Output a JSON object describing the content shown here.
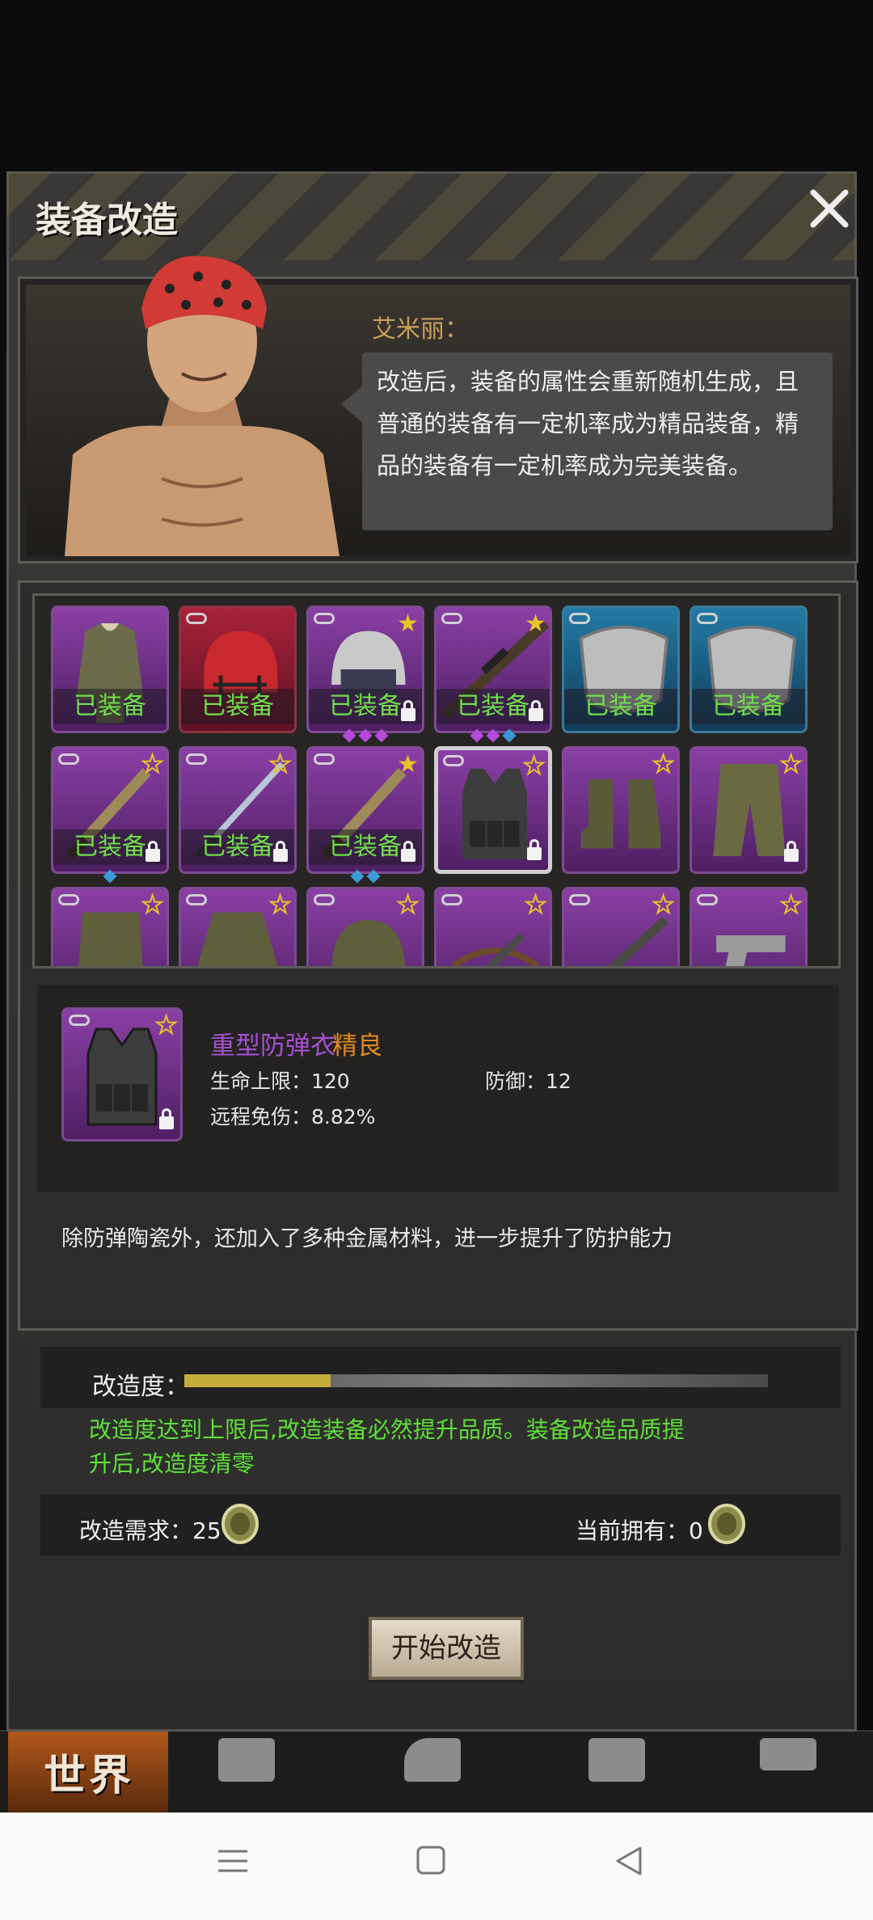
{
  "dialog": {
    "title": "装备改造",
    "npc_name": "艾米丽：",
    "npc_speech": "改造后，装备的属性会重新随机生成，且普通的装备有一定机率成为精品装备，精品的装备有一定机率成为完美装备。"
  },
  "inventory": {
    "equipped_label": "已装备",
    "slots": [
      {
        "icon": "parka-jacket-icon",
        "frame": "purple",
        "equipped": true,
        "linked": false,
        "star": "none",
        "locked": false,
        "gems": []
      },
      {
        "icon": "football-helmet-icon",
        "frame": "red",
        "equipped": true,
        "linked": true,
        "star": "none",
        "locked": false,
        "gems": []
      },
      {
        "icon": "police-helmet-icon",
        "frame": "purple",
        "equipped": true,
        "linked": true,
        "star": "filled",
        "locked": true,
        "gems": [
          "purple",
          "purple",
          "purple"
        ]
      },
      {
        "icon": "sniper-rifle-icon",
        "frame": "purple",
        "equipped": true,
        "linked": true,
        "star": "filled",
        "locked": true,
        "gems": [
          "purple",
          "purple",
          "blue"
        ]
      },
      {
        "icon": "metal-shield-icon",
        "frame": "blue",
        "equipped": true,
        "linked": true,
        "star": "none",
        "locked": false,
        "gems": []
      },
      {
        "icon": "metal-shield-icon",
        "frame": "blue",
        "equipped": true,
        "linked": true,
        "star": "none",
        "locked": false,
        "gems": []
      },
      {
        "icon": "machete-icon",
        "frame": "purple",
        "equipped": true,
        "linked": true,
        "star": "hollow",
        "locked": true,
        "gems": [
          "blue"
        ]
      },
      {
        "icon": "katana-icon",
        "frame": "purple",
        "equipped": true,
        "linked": true,
        "star": "hollow",
        "locked": true,
        "gems": []
      },
      {
        "icon": "machete-icon",
        "frame": "purple",
        "equipped": true,
        "linked": true,
        "star": "filled",
        "locked": true,
        "gems": [
          "blue",
          "blue"
        ]
      },
      {
        "icon": "tactical-vest-icon",
        "frame": "purple",
        "equipped": false,
        "linked": true,
        "star": "hollow",
        "locked": true,
        "selected": true,
        "gems": []
      },
      {
        "icon": "camo-boots-icon",
        "frame": "purple",
        "equipped": false,
        "linked": false,
        "star": "hollow",
        "locked": false,
        "gems": []
      },
      {
        "icon": "camo-pants-icon",
        "frame": "purple",
        "equipped": false,
        "linked": false,
        "star": "hollow",
        "locked": true,
        "gems": []
      },
      {
        "icon": "camo-vest-icon",
        "frame": "purple",
        "equipped": false,
        "linked": true,
        "star": "hollow",
        "locked": false,
        "gems": []
      },
      {
        "icon": "camo-jacket-icon",
        "frame": "purple",
        "equipped": false,
        "linked": true,
        "star": "hollow",
        "locked": false,
        "gems": []
      },
      {
        "icon": "camo-helmet-icon",
        "frame": "purple",
        "equipped": false,
        "linked": true,
        "star": "hollow",
        "locked": false,
        "gems": []
      },
      {
        "icon": "crossbow-icon",
        "frame": "purple",
        "equipped": false,
        "linked": true,
        "star": "hollow",
        "locked": false,
        "gems": []
      },
      {
        "icon": "rifle-icon",
        "frame": "purple",
        "equipped": false,
        "linked": true,
        "star": "hollow",
        "locked": false,
        "gems": []
      },
      {
        "icon": "pistol-icon",
        "frame": "purple",
        "equipped": false,
        "linked": true,
        "star": "hollow",
        "locked": false,
        "gems": []
      }
    ]
  },
  "selected_item": {
    "name": "重型防弹衣",
    "quality": "精良",
    "stats": {
      "max_hp": "生命上限：120",
      "defense": "防御：12",
      "ranged_reduction": "远程免伤：8.82%"
    },
    "description": "除防弹陶瓷外，还加入了多种金属材料，进一步提升了防护能力"
  },
  "modify": {
    "progress_label": "改造度：",
    "progress_fraction": 0.25,
    "note": "改造度达到上限后,改造装备必然提升品质。装备改造品质提升后,改造度清零",
    "requirement_label": "改造需求：25",
    "owned_label": "当前拥有：0",
    "start_button": "开始改造"
  },
  "bottom_nav": {
    "world_label": "世界"
  },
  "colors": {
    "equipped_text": "#6ee04a",
    "item_name": "#a54fd0",
    "quality_good": "#e58a1e",
    "note_text": "#5fe03a",
    "progress_fill": "#c4ad3b"
  }
}
